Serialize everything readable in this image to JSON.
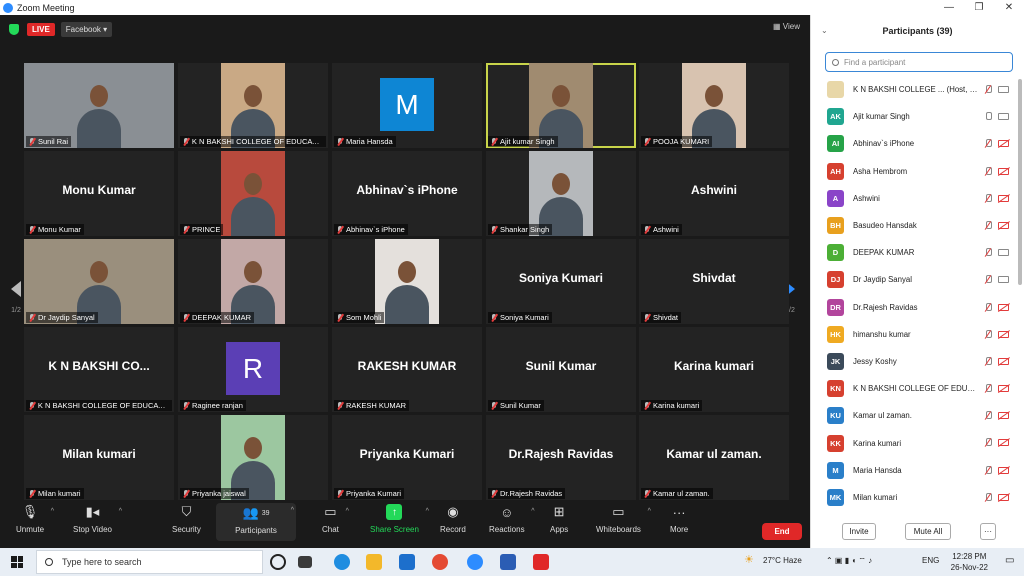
{
  "window": {
    "title": "Zoom Meeting"
  },
  "topbar": {
    "live": "LIVE",
    "stream": "Facebook ▾",
    "view": "View"
  },
  "tiles": [
    {
      "label": "Sunil Rai",
      "big": "",
      "type": "photo",
      "bg": "#8a8f94"
    },
    {
      "label": "K N BAKSHI COLLEGE OF EDUCATI...",
      "big": "",
      "type": "photo",
      "bg": "#c9a985"
    },
    {
      "label": "Maria Hansda",
      "big": "",
      "type": "avatar",
      "letter": "M",
      "color": "#0e86d4"
    },
    {
      "label": "Ajit kumar Singh",
      "big": "",
      "type": "photo",
      "bg": "#a08b70",
      "active": true
    },
    {
      "label": "POOJA KUMARI",
      "big": "",
      "type": "photo",
      "bg": "#d8c3b0"
    },
    {
      "label": "Monu Kumar",
      "big": "Monu Kumar",
      "type": "name"
    },
    {
      "label": "PRINCE",
      "big": "",
      "type": "photo",
      "bg": "#b84a3d"
    },
    {
      "label": "Abhinav`s iPhone",
      "big": "Abhinav`s iPhone",
      "type": "name"
    },
    {
      "label": "Shankar Singh",
      "big": "",
      "type": "photo",
      "bg": "#b5b8bb"
    },
    {
      "label": "Ashwini",
      "big": "Ashwini",
      "type": "name"
    },
    {
      "label": "Dr Jaydip Sanyal",
      "big": "",
      "type": "photo",
      "bg": "#9a8f7d"
    },
    {
      "label": "DEEPAK KUMAR",
      "big": "",
      "type": "photo",
      "bg": "#c2a8a6"
    },
    {
      "label": "Som Mohli",
      "big": "",
      "type": "photo",
      "bg": "#e4e0dc"
    },
    {
      "label": "Soniya Kumari",
      "big": "Soniya Kumari",
      "type": "name"
    },
    {
      "label": "Shivdat",
      "big": "Shivdat",
      "type": "name"
    },
    {
      "label": "K N BAKSHI COLLEGE OF EDUCATI...",
      "big": "K N BAKSHI CO...",
      "type": "name"
    },
    {
      "label": "Raginee ranjan",
      "big": "",
      "type": "avatar",
      "letter": "R",
      "color": "#5b3fb5"
    },
    {
      "label": "RAKESH KUMAR",
      "big": "RAKESH KUMAR",
      "type": "name"
    },
    {
      "label": "Sunil Kumar",
      "big": "Sunil Kumar",
      "type": "name"
    },
    {
      "label": "Karina kumari",
      "big": "Karina kumari",
      "type": "name"
    },
    {
      "label": "Milan kumari",
      "big": "Milan kumari",
      "type": "name"
    },
    {
      "label": "Priyanka jaiswal",
      "big": "",
      "type": "photo",
      "bg": "#9cc7a0"
    },
    {
      "label": "Priyanka Kumari",
      "big": "Priyanka Kumari",
      "type": "name"
    },
    {
      "label": "Dr.Rajesh Ravidas",
      "big": "Dr.Rajesh Ravidas",
      "type": "name"
    },
    {
      "label": "Kamar ul zaman.",
      "big": "Kamar ul zaman.",
      "type": "name"
    }
  ],
  "nav": {
    "page": "1/2"
  },
  "toolbar": {
    "unmute": "Unmute",
    "stop_video": "Stop Video",
    "security": "Security",
    "participants": "Participants",
    "participants_count": "39",
    "chat": "Chat",
    "share": "Share Screen",
    "record": "Record",
    "reactions": "Reactions",
    "apps": "Apps",
    "whiteboards": "Whiteboards",
    "more": "More",
    "end": "End"
  },
  "panel": {
    "title": "Participants (39)",
    "search_placeholder": "Find a participant",
    "invite": "Invite",
    "mute_all": "Mute All",
    "more": "···",
    "participants": [
      {
        "initials": "",
        "name": "K N BAKSHI COLLEGE ... (Host, me)",
        "color": "#e8d7a8",
        "mic": "muted",
        "cam": "on"
      },
      {
        "initials": "AK",
        "name": "Ajit kumar Singh",
        "color": "#20a690",
        "mic": "on",
        "cam": "on"
      },
      {
        "initials": "AI",
        "name": "Abhinav`s iPhone",
        "color": "#26a348",
        "mic": "muted",
        "cam": "off"
      },
      {
        "initials": "AH",
        "name": "Asha Hembrom",
        "color": "#d6402f",
        "mic": "muted",
        "cam": "off"
      },
      {
        "initials": "A",
        "name": "Ashwini",
        "color": "#8a44c8",
        "mic": "muted",
        "cam": "off"
      },
      {
        "initials": "BH",
        "name": "Basudeo Hansdak",
        "color": "#e8a01e",
        "mic": "muted",
        "cam": "off"
      },
      {
        "initials": "D",
        "name": "DEEPAK KUMAR",
        "color": "#4caf36",
        "mic": "muted",
        "cam": "on"
      },
      {
        "initials": "DJ",
        "name": "Dr Jaydip Sanyal",
        "color": "#d6402f",
        "mic": "muted",
        "cam": "on"
      },
      {
        "initials": "DR",
        "name": "Dr.Rajesh Ravidas",
        "color": "#b2459c",
        "mic": "muted",
        "cam": "off"
      },
      {
        "initials": "HK",
        "name": "himanshu kumar",
        "color": "#efaa22",
        "mic": "muted",
        "cam": "off"
      },
      {
        "initials": "JK",
        "name": "Jessy Koshy",
        "color": "#3b4a5a",
        "mic": "muted",
        "cam": "off"
      },
      {
        "initials": "KN",
        "name": "K N BAKSHI COLLEGE OF EDUCA...",
        "color": "#d6402f",
        "mic": "muted",
        "cam": "off"
      },
      {
        "initials": "KU",
        "name": "Kamar ul zaman.",
        "color": "#2a7fc9",
        "mic": "muted",
        "cam": "off"
      },
      {
        "initials": "KK",
        "name": "Karina kumari",
        "color": "#d6402f",
        "mic": "muted",
        "cam": "off"
      },
      {
        "initials": "M",
        "name": "Maria Hansda",
        "color": "#2a7fc9",
        "mic": "muted",
        "cam": "off"
      },
      {
        "initials": "MK",
        "name": "Milan kumari",
        "color": "#2a7fc9",
        "mic": "muted",
        "cam": "off"
      }
    ]
  },
  "taskbar": {
    "search_placeholder": "Type here to search",
    "weather": "27°C  Haze",
    "lang": "ENG",
    "time": "12:28 PM",
    "date": "26-Nov-22"
  }
}
